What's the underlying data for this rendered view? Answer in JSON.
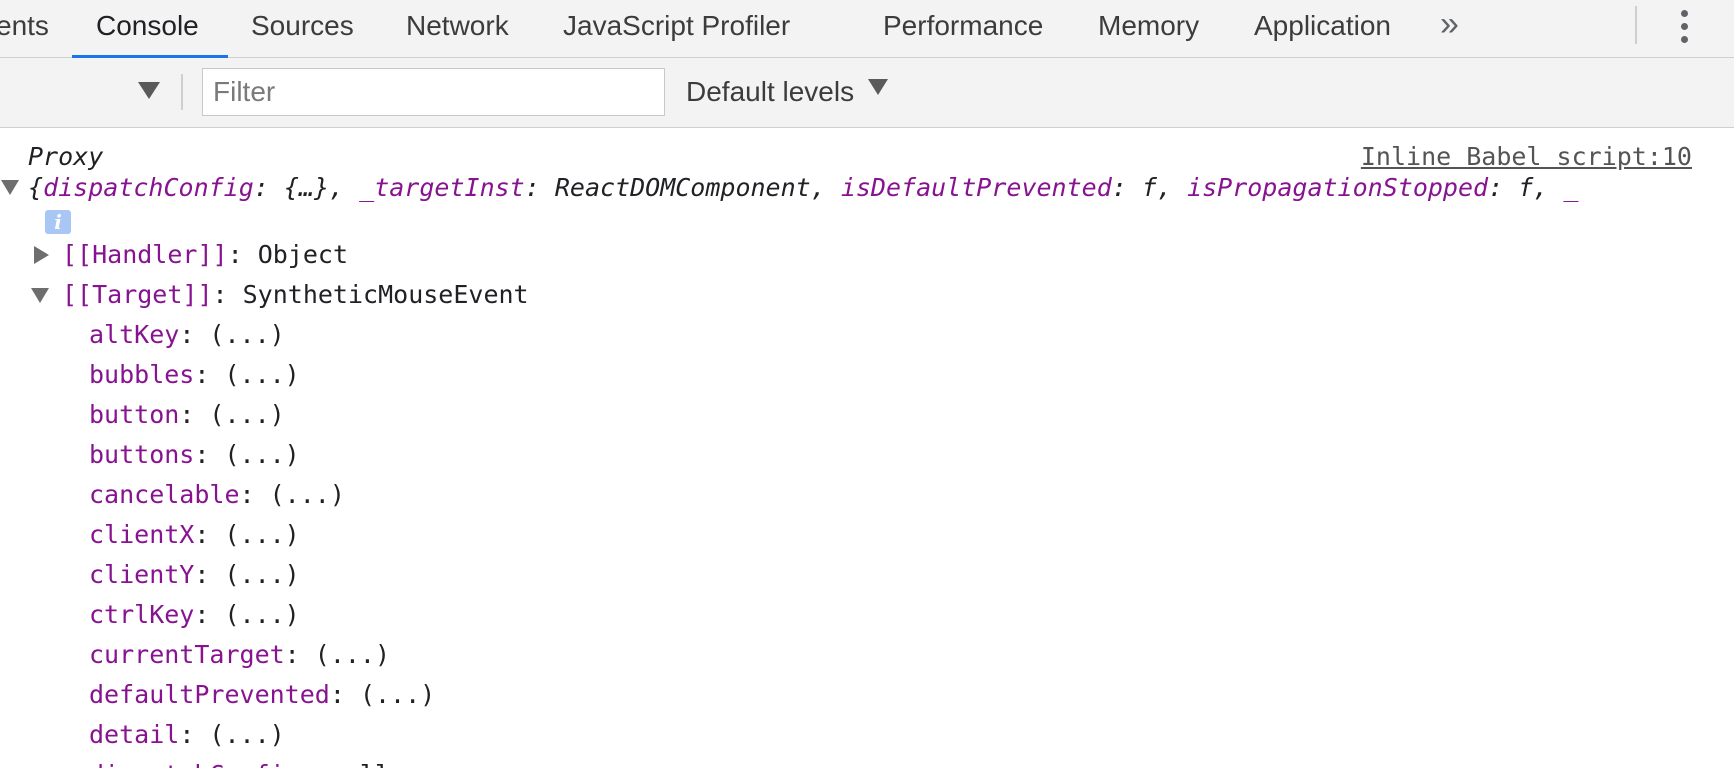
{
  "tabs": [
    {
      "label": "ents",
      "active": false
    },
    {
      "label": "Console",
      "active": true
    },
    {
      "label": "Sources",
      "active": false
    },
    {
      "label": "Network",
      "active": false
    },
    {
      "label": "JavaScript Profiler",
      "active": false
    },
    {
      "label": "Performance",
      "active": false
    },
    {
      "label": "Memory",
      "active": false
    },
    {
      "label": "Application",
      "active": false
    }
  ],
  "tabbar": {
    "overflow_label": "»",
    "menu_icon": "kebab-menu-icon",
    "accent_color": "#1a73e8"
  },
  "toolbar": {
    "context_icon": "context-dropdown-arrow-icon",
    "filter": {
      "value": "",
      "placeholder": "Filter"
    },
    "levels_label": "Default levels"
  },
  "console": {
    "source_link": "Inline Babel script:10",
    "header_label": "Proxy",
    "summary": {
      "open": "{",
      "entries": [
        {
          "key": "dispatchConfig",
          "value": "{…}"
        },
        {
          "key": "_targetInst",
          "value": "ReactDOMComponent"
        },
        {
          "key": "isDefaultPrevented",
          "value": "f"
        },
        {
          "key": "isPropagationStopped",
          "value": "f"
        },
        {
          "key": "_",
          "value": ""
        }
      ]
    },
    "info_badge": "i",
    "handler": {
      "key": "[[Handler]]",
      "value": "Object",
      "expanded": false
    },
    "target": {
      "key": "[[Target]]",
      "value": "SyntheticMouseEvent",
      "expanded": true
    },
    "properties": [
      {
        "key": "altKey",
        "value": "(...)"
      },
      {
        "key": "bubbles",
        "value": "(...)"
      },
      {
        "key": "button",
        "value": "(...)"
      },
      {
        "key": "buttons",
        "value": "(...)"
      },
      {
        "key": "cancelable",
        "value": "(...)"
      },
      {
        "key": "clientX",
        "value": "(...)"
      },
      {
        "key": "clientY",
        "value": "(...)"
      },
      {
        "key": "ctrlKey",
        "value": "(...)"
      },
      {
        "key": "currentTarget",
        "value": "(...)"
      },
      {
        "key": "defaultPrevented",
        "value": "(...)"
      },
      {
        "key": "detail",
        "value": "(...)"
      },
      {
        "key": "dispatchConfig",
        "value": "null"
      }
    ],
    "colors": {
      "key": "#881391",
      "text": "#202124",
      "link": "#545454"
    }
  }
}
